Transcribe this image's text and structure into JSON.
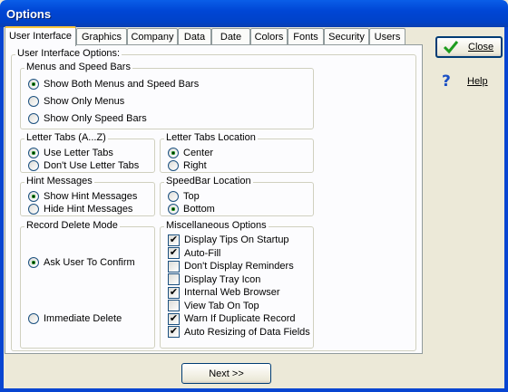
{
  "window": {
    "title": "Options"
  },
  "tabs": [
    "User Interface",
    "Graphics",
    "Company",
    "Data",
    "Date",
    "Colors",
    "Fonts",
    "Security",
    "Users"
  ],
  "panel": {
    "heading": "User Interface Options:",
    "menus_group": {
      "title": "Menus and Speed Bars",
      "options": [
        "Show Both Menus and Speed Bars",
        "Show Only Menus",
        "Show Only Speed Bars"
      ],
      "selected_index": 0
    },
    "letter_tabs": {
      "title": "Letter Tabs (A...Z)",
      "options": [
        "Use Letter Tabs",
        "Don't Use Letter Tabs"
      ],
      "selected_index": 0
    },
    "letter_tabs_location": {
      "title": "Letter Tabs Location",
      "options": [
        "Center",
        "Right"
      ],
      "selected_index": 0
    },
    "hint_messages": {
      "title": "Hint Messages",
      "options": [
        "Show Hint Messages",
        "Hide Hint Messages"
      ],
      "selected_index": 0
    },
    "speedbar_location": {
      "title": "SpeedBar Location",
      "options": [
        "Top",
        "Bottom"
      ],
      "selected_index": 1
    },
    "record_delete": {
      "title": "Record Delete Mode",
      "options": [
        "Ask User To Confirm",
        "Immediate Delete"
      ],
      "selected_index": 0
    },
    "misc": {
      "title": "Miscellaneous Options",
      "items": [
        {
          "label": "Display Tips On Startup",
          "checked": true
        },
        {
          "label": "Auto-Fill",
          "checked": true
        },
        {
          "label": "Don't Display Reminders",
          "checked": false
        },
        {
          "label": "Display Tray Icon",
          "checked": false
        },
        {
          "label": "Internal Web Browser",
          "checked": true
        },
        {
          "label": "View Tab On Top",
          "checked": false
        },
        {
          "label": "Warn If Duplicate Record",
          "checked": true
        },
        {
          "label": "Auto Resizing of Data Fields",
          "checked": true
        }
      ]
    }
  },
  "buttons": {
    "close": "Close",
    "help": "Help",
    "next": "Next >>",
    "close_icon": "checkmark-icon",
    "help_icon": "question-mark-icon"
  },
  "colors": {
    "titlebar": "#0046d5",
    "close_check": "#1e9c1e",
    "help_mark": "#1a4fc4",
    "active_tab_highlight": "#ffc83c"
  }
}
